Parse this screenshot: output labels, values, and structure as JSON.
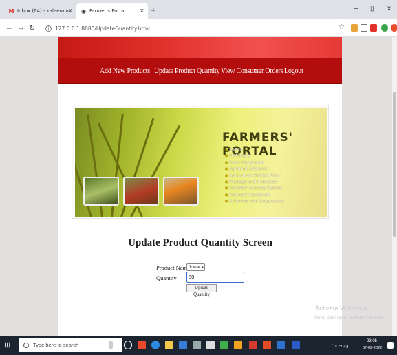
{
  "browser": {
    "tabs": [
      {
        "title": "Inbox (64) - kaleem.mmd@gmai",
        "close": "x"
      },
      {
        "title": "Farmer's Portal",
        "close": "x"
      }
    ],
    "new_tab": "+",
    "window_controls": {
      "minimize": "–",
      "restore": "▯",
      "close": "x"
    },
    "url": "127.0.0.1:8080/UpdateQuantity.html"
  },
  "page": {
    "menu": [
      "Add New Products",
      "Update Product Quantity",
      "View Consumer Orders",
      "Logout"
    ],
    "portal_image": {
      "title": "FARMERS' PORTAL",
      "items": [
        "Seeds",
        "Fertilizers",
        "Farm Equipment",
        "Agromet Advisory",
        "Agriculture Market Price",
        "Package and Practices",
        "Farmers' Success Stories",
        "Farmers' Handbook",
        "Schemes and Programme"
      ]
    },
    "form": {
      "title": "Update Product Quantity Screen",
      "product_label": "Product Name",
      "product_value": "Jowar",
      "quantity_label": "Quantity",
      "quantity_value": "80",
      "submit_label": "Update Quantity"
    }
  },
  "watermark": {
    "line1": "Activate Windows",
    "line2": "Go to Settings to activate Windows."
  },
  "taskbar": {
    "search_placeholder": "Type here to search",
    "time": "23:05",
    "date": "07-02-2022"
  },
  "colors": {
    "menu_bg": "#b30d0d",
    "banner": "#e0302a",
    "taskbar": "#1c2430"
  }
}
